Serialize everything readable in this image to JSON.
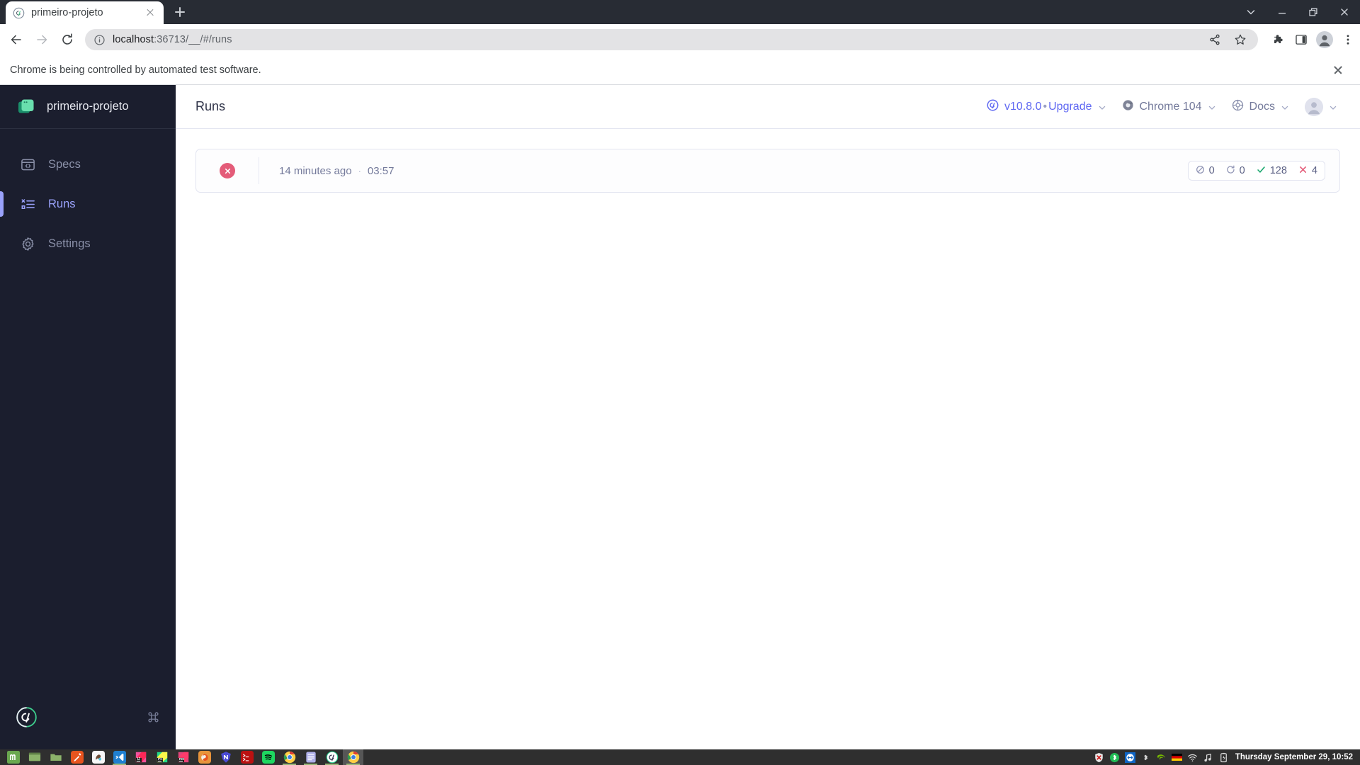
{
  "browser": {
    "tab": {
      "title": "primeiro-projeto",
      "favicon": "cypress-favicon",
      "close": "close-tab-icon"
    },
    "new_tab_label": "new-tab-icon",
    "window_controls": [
      "tab-search-chevron-icon",
      "minimize-icon",
      "restore-icon",
      "close-window-icon"
    ],
    "toolbar": {
      "back": "back-arrow-icon",
      "forward": "forward-arrow-icon",
      "reload": "reload-icon",
      "site_info": "info-circle-icon",
      "url_host": "localhost",
      "url_rest": ":36713/__/#/runs",
      "url_full": "localhost:36713/__/#/runs",
      "share": "share-icon",
      "bookmark": "star-icon",
      "extensions": "puzzle-icon",
      "side_panel": "side-panel-icon",
      "profile": "profile-avatar-icon",
      "menu": "three-dot-menu-icon"
    },
    "infobar": {
      "text": "Chrome is being controlled by automated test software.",
      "close": "close-icon"
    }
  },
  "app": {
    "sidebar": {
      "project_name": "primeiro-projeto",
      "project_icon": "project-square-icon",
      "items": [
        {
          "label": "Specs",
          "icon": "specs-window-icon",
          "active": false
        },
        {
          "label": "Runs",
          "icon": "runs-list-icon",
          "active": true
        },
        {
          "label": "Settings",
          "icon": "gear-icon",
          "active": false
        }
      ],
      "footer": {
        "logo": "cypress-cy-logo",
        "shortcut": "command-key-icon"
      }
    },
    "header": {
      "title": "Runs",
      "version": {
        "icon": "cypress-logo-icon",
        "version_label": "v10.8.0",
        "separator": "•",
        "upgrade_label": "Upgrade",
        "caret": "chevron-down-icon"
      },
      "browser_selector": {
        "icon": "chrome-icon",
        "label": "Chrome 104",
        "caret": "chevron-down-icon"
      },
      "docs": {
        "icon": "docs-icon",
        "label": "Docs",
        "caret": "chevron-down-icon"
      },
      "account": {
        "avatar": "user-avatar-icon",
        "caret": "chevron-down-icon"
      }
    },
    "runs": [
      {
        "status": "failed",
        "status_icon": "failed-x-circle-icon",
        "relative_time": "14 minutes ago",
        "separator": "·",
        "duration": "03:57",
        "badges": [
          {
            "name": "skipped",
            "icon": "skipped-circle-slash-icon",
            "value": "0",
            "color": "#9095b5"
          },
          {
            "name": "pending",
            "icon": "pending-arrow-icon",
            "value": "0",
            "color": "#9095b5"
          },
          {
            "name": "passed",
            "icon": "check-icon",
            "value": "128",
            "color": "#1fa971"
          },
          {
            "name": "failed",
            "icon": "x-icon",
            "value": "4",
            "color": "#e45c79"
          }
        ]
      }
    ]
  },
  "taskbar": {
    "apps": [
      {
        "name": "linux-mint-menu-icon",
        "running": false,
        "focused": false
      },
      {
        "name": "terminal-icon",
        "running": false,
        "focused": false
      },
      {
        "name": "files-icon",
        "running": false,
        "focused": false
      },
      {
        "name": "dropper-icon",
        "running": false,
        "focused": false
      },
      {
        "name": "gimp-icon",
        "running": false,
        "focused": false
      },
      {
        "name": "vscode-icon",
        "running": true,
        "focused": false
      },
      {
        "name": "intellij-idea-icon",
        "running": false,
        "focused": false
      },
      {
        "name": "pycharm-icon",
        "running": false,
        "focused": false
      },
      {
        "name": "rubymine-icon",
        "running": false,
        "focused": false
      },
      {
        "name": "firefox-icon",
        "running": false,
        "focused": false
      },
      {
        "name": "notion-icon",
        "running": false,
        "focused": false
      },
      {
        "name": "console-icon",
        "running": false,
        "focused": false
      },
      {
        "name": "spotify-icon",
        "running": false,
        "focused": false
      },
      {
        "name": "chrome-icon",
        "running": true,
        "focused": false
      },
      {
        "name": "text-editor-icon",
        "running": true,
        "focused": false
      },
      {
        "name": "cypress-icon",
        "running": true,
        "focused": false
      },
      {
        "name": "chrome-active-icon",
        "running": true,
        "focused": true
      }
    ],
    "tray": [
      "shield-blocked-icon",
      "bluetooth-green-icon",
      "teamviewer-icon",
      "bluetooth-icon",
      "nvidia-icon",
      "german-flag-icon",
      "wifi-icon",
      "music-note-icon",
      "battery-icon"
    ],
    "clock": "Thursday September 29, 10:52"
  },
  "colors": {
    "sidebar_bg": "#1b1e2e",
    "accent_indigo": "#5f68f2",
    "active_purple": "#9aa2fb",
    "fail_red": "#e45c79",
    "pass_green": "#1fa971",
    "chrome_tabstrip": "#282c34"
  }
}
